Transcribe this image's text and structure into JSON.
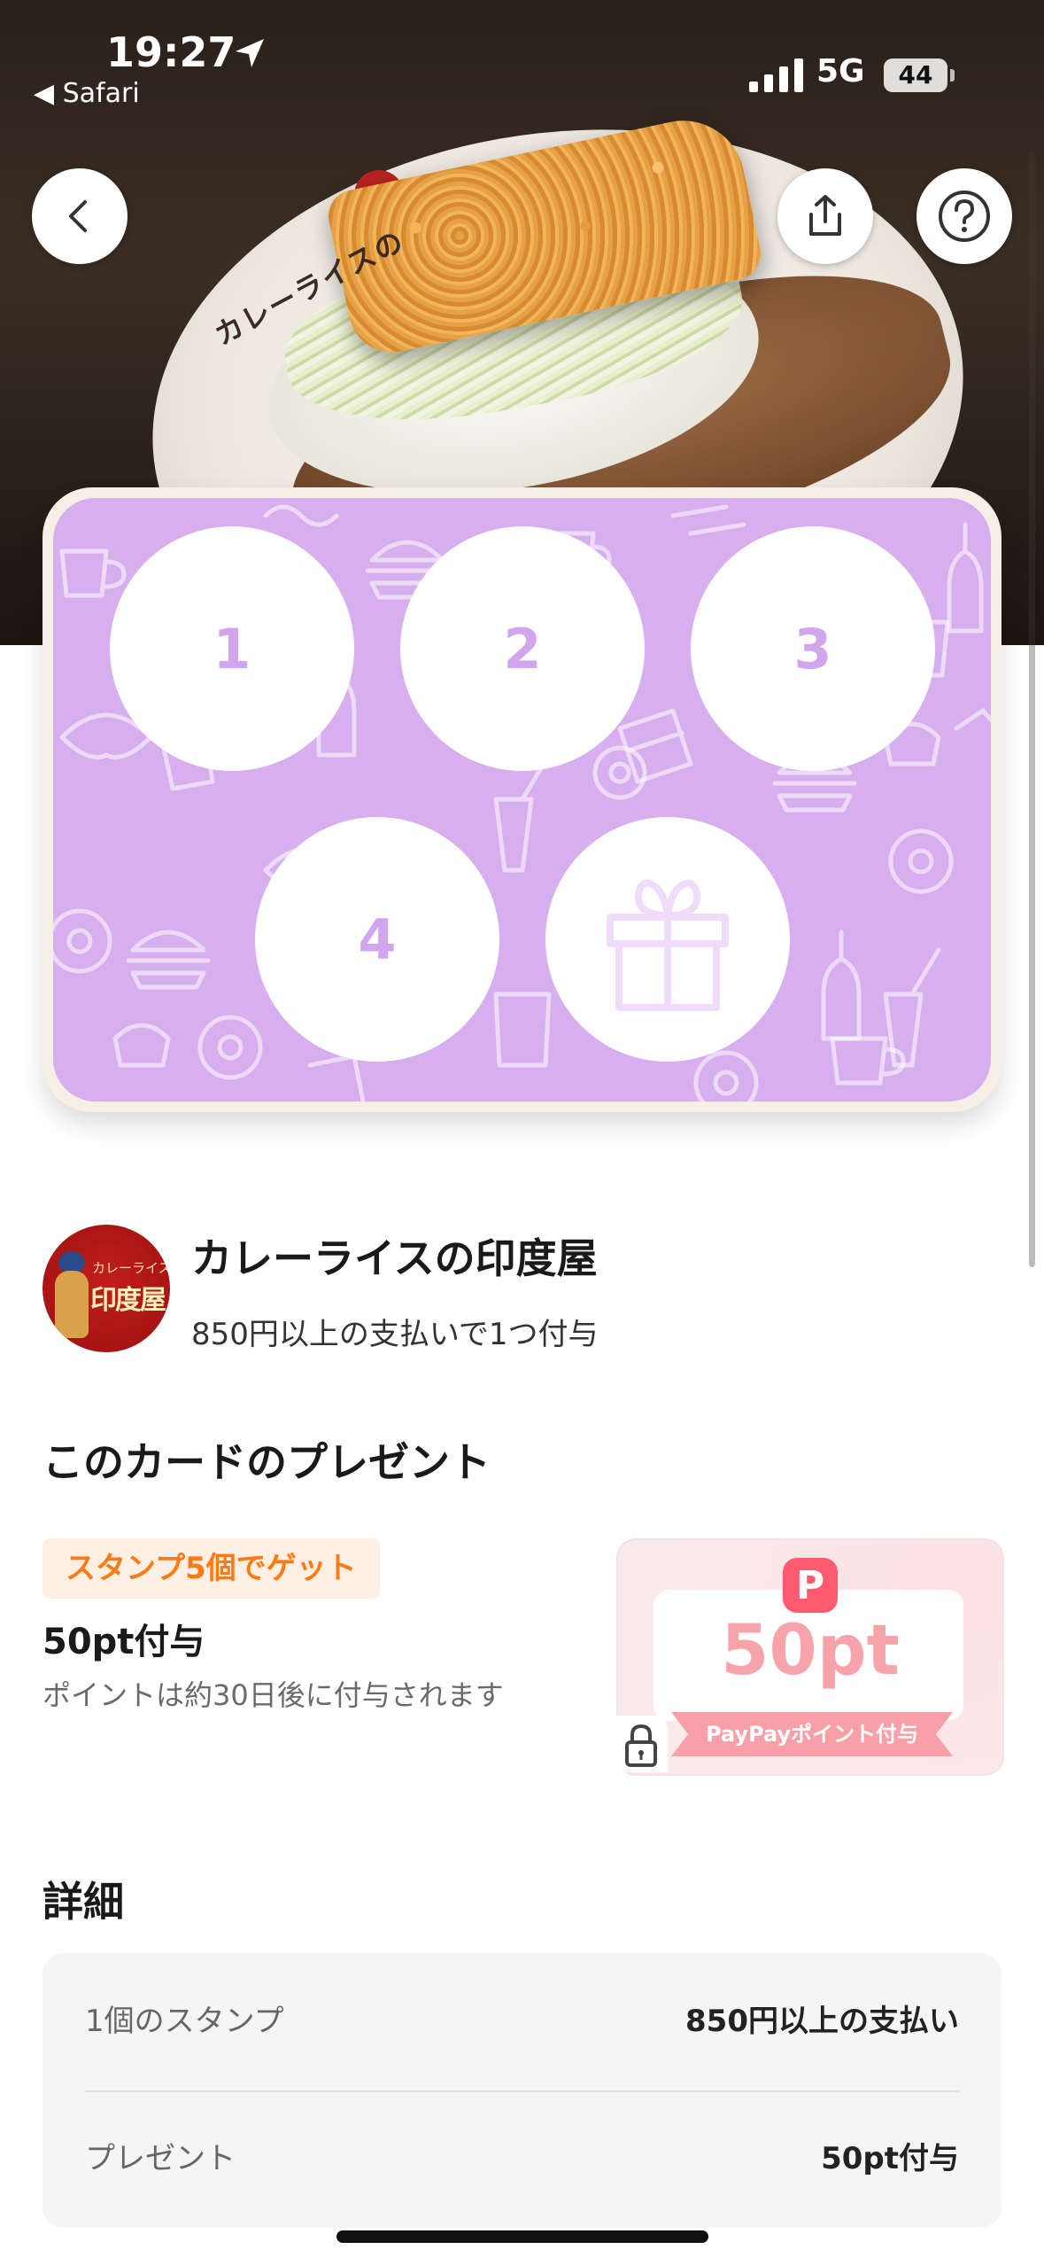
{
  "status_bar": {
    "time": "19:27",
    "back_app": "◀ Safari",
    "network": "5G",
    "battery": "44"
  },
  "hero": {
    "plate_text": "カレーライスの"
  },
  "nav": {
    "back_icon": "chevron-left-icon",
    "share_icon": "share-icon",
    "help_icon": "question-circle-icon"
  },
  "stamp_card": {
    "background_color": "#d7aeee",
    "stamps": [
      "1",
      "2",
      "3",
      "4"
    ],
    "final_icon": "gift-icon"
  },
  "shop": {
    "logo_small": "カレーライスの",
    "logo_big": "印度屋",
    "name": "カレーライスの印度屋",
    "condition": "850円以上の支払いで1つ付与"
  },
  "present": {
    "section_title": "このカードのプレゼント",
    "badge": "スタンプ5個でゲット",
    "badge_color": "#ff7a14",
    "title": "50pt付与",
    "note": "ポイントは約30日後に付与されます",
    "paypay_logo": "P",
    "paypay_amount": "50pt",
    "paypay_ribbon": "PayPayポイント付与",
    "lock_icon": "lock-icon"
  },
  "details": {
    "section_title": "詳細",
    "rows": [
      {
        "label": "1個のスタンプ",
        "value": "850円以上の支払い"
      },
      {
        "label": "プレゼント",
        "value": "50pt付与"
      }
    ]
  }
}
